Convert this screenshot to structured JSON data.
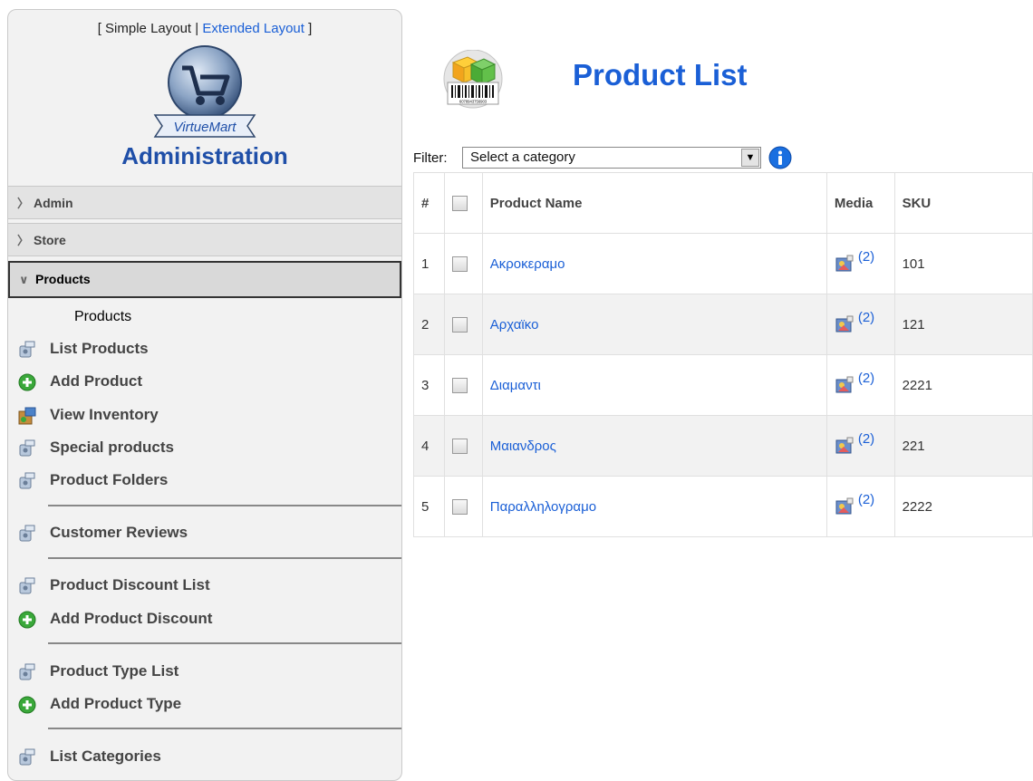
{
  "sidebar": {
    "layout_switch": {
      "open_bracket": "[ ",
      "simple": "Simple Layout",
      "sep": " | ",
      "extended": "Extended Layout",
      "close_bracket": " ]"
    },
    "logo_text": "VirtueMart",
    "title": "Administration",
    "sections": [
      {
        "label": "Admin",
        "state": "collapsed"
      },
      {
        "label": "Store",
        "state": "collapsed"
      },
      {
        "label": "Products",
        "state": "expanded"
      }
    ],
    "products_heading": "Products",
    "items": [
      {
        "label": "List Products",
        "icon": "list-icon"
      },
      {
        "label": "Add Product",
        "icon": "add-icon"
      },
      {
        "label": "View Inventory",
        "icon": "inventory-icon"
      },
      {
        "label": "Special products",
        "icon": "list-icon"
      },
      {
        "label": "Product Folders",
        "icon": "list-icon"
      },
      {
        "label": "Customer Reviews",
        "icon": "list-icon"
      },
      {
        "label": "Product Discount List",
        "icon": "list-icon"
      },
      {
        "label": "Add Product Discount",
        "icon": "add-icon"
      },
      {
        "label": "Product Type List",
        "icon": "list-icon"
      },
      {
        "label": "Add Product Type",
        "icon": "add-icon"
      },
      {
        "label": "List Categories",
        "icon": "list-icon"
      }
    ]
  },
  "main": {
    "title": "Product List",
    "barcode_text": "6078943756903",
    "filter": {
      "label": "Filter:",
      "selected": "Select a category"
    },
    "table": {
      "headers": {
        "num": "#",
        "name": "Product Name",
        "media": "Media",
        "sku": "SKU"
      },
      "rows": [
        {
          "num": "1",
          "name": "Ακροκεραμο",
          "media": "(2)",
          "sku": "101"
        },
        {
          "num": "2",
          "name": "Αρχαϊκο",
          "media": "(2)",
          "sku": "121"
        },
        {
          "num": "3",
          "name": "Διαμαντι",
          "media": "(2)",
          "sku": "2221"
        },
        {
          "num": "4",
          "name": "Μαιανδρος",
          "media": "(2)",
          "sku": "221"
        },
        {
          "num": "5",
          "name": "Παραλληλογραμο",
          "media": "(2)",
          "sku": "2222"
        }
      ]
    }
  },
  "colors": {
    "accent": "#1a5fd6",
    "title_blue": "#1f4fa8",
    "add_green": "#3aa83a"
  }
}
